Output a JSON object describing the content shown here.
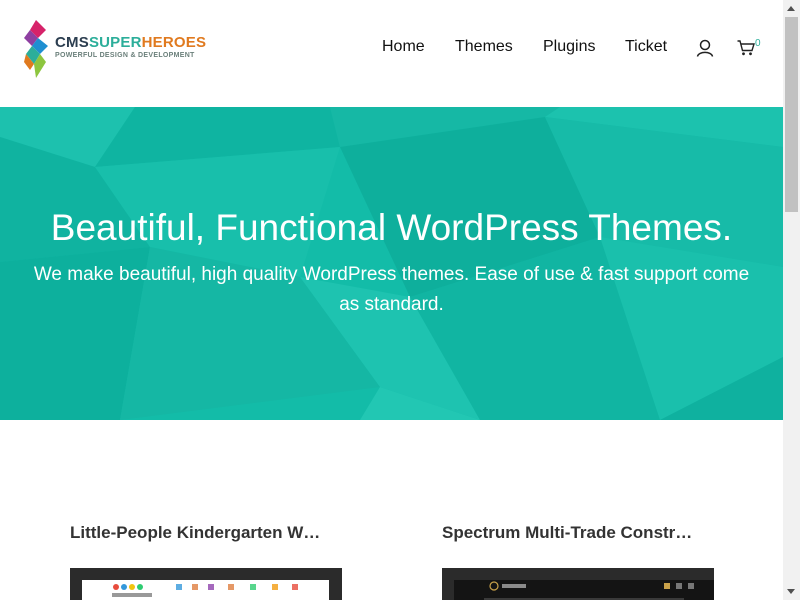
{
  "brand": {
    "name_part1": "CMS",
    "name_part2": "SUPER",
    "name_part3": "HEROES",
    "tagline": "POWERFUL DESIGN & DEVELOPMENT",
    "colors": {
      "dark": "#2c3e50",
      "teal": "#2cae9a",
      "orange": "#e07a1f"
    }
  },
  "nav": {
    "items": [
      {
        "label": "Home"
      },
      {
        "label": "Themes"
      },
      {
        "label": "Plugins"
      },
      {
        "label": "Ticket"
      }
    ],
    "user_icon": "user-icon",
    "cart_icon": "cart-icon",
    "cart_count": "0"
  },
  "hero": {
    "title": "Beautiful, Functional WordPress Themes.",
    "subtitle": "We make beautiful, high quality WordPress themes. Ease of use & fast support come as standard.",
    "background_color": "#13bca8"
  },
  "cards": [
    {
      "title": "Little-People Kindergarten W…"
    },
    {
      "title": "Spectrum Multi-Trade Constr…"
    }
  ]
}
